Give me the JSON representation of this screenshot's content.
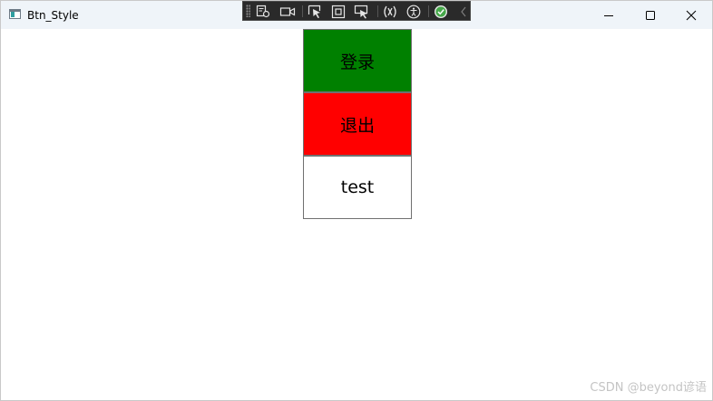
{
  "window": {
    "title": "Btn_Style",
    "icon": "app-window-icon",
    "controls": [
      "minimize-icon",
      "maximize-icon",
      "close-icon"
    ]
  },
  "debug_toolbar": {
    "tools": [
      "live-visual-tree-icon",
      "record-icon",
      "select-element-icon",
      "display-layout-adorners-icon",
      "track-focused-element-icon",
      "binding-failures-icon",
      "accessibility-icon",
      "check-icon",
      "collapse-icon"
    ]
  },
  "buttons": [
    {
      "label": "登录",
      "background": "#008000"
    },
    {
      "label": "退出",
      "background": "#ff0000"
    },
    {
      "label": "test",
      "background": "#ffffff"
    }
  ],
  "watermark": "CSDN @beyond谚语"
}
